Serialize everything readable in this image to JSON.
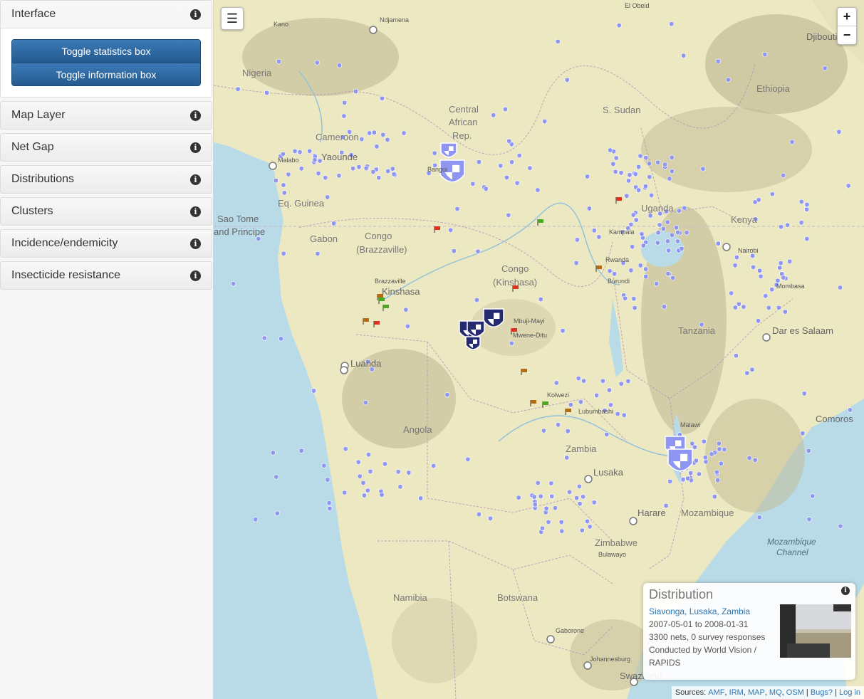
{
  "sidebar": {
    "interface": {
      "title": "Interface",
      "toggle_stats": "Toggle statistics box",
      "toggle_info": "Toggle information box"
    },
    "panels": [
      "Map Layer",
      "Net Gap",
      "Distributions",
      "Clusters",
      "Incidence/endemicity",
      "Insecticide resistance"
    ]
  },
  "map": {
    "menu_icon": "hamburger-icon",
    "zoom_in": "+",
    "zoom_out": "−",
    "labels": {
      "nigeria": "Nigeria",
      "cameroon": "Cameroon",
      "central_african_rep_1": "Central",
      "central_african_rep_2": "African",
      "central_african_rep_3": "Rep.",
      "s_sudan": "S. Sudan",
      "ethiopia": "Ethiopia",
      "eq_guinea": "Eq. Guinea",
      "gabon": "Gabon",
      "congo_brazza_1": "Congo",
      "congo_brazza_2": "(Brazzaville)",
      "congo_kin_1": "Congo",
      "congo_kin_2": "(Kinshasa)",
      "uganda": "Uganda",
      "kenya": "Kenya",
      "rwanda": "Rwanda",
      "burundi": "Burundi",
      "tanzania": "Tanzania",
      "angola": "Angola",
      "zambia": "Zambia",
      "malawi": "Malawi",
      "mozambique": "Mozambique",
      "zimbabwe": "Zimbabwe",
      "namibia": "Namibia",
      "botswana": "Botswana",
      "sao_tome_1": "Sao Tome",
      "sao_tome_2": "and Principe",
      "mozambique_channel_1": "Mozambique",
      "mozambique_channel_2": "Channel",
      "comoros": "Comoros",
      "djibouti": "Djibouti",
      "swaziland": "Swaziland",
      "kinshasa": "Kinshasa",
      "luanda": "Luanda",
      "lusaka": "Lusaka",
      "harare": "Harare",
      "dar_es_salaam": "Dar es Salaam",
      "nairobi": "Nairobi",
      "yaounde": "Yaounde",
      "malabo": "Malabo",
      "ndjamena": "Ndjamena",
      "kano": "Kano",
      "johannesburg": "Johannesburg",
      "gaborone": "Gaborone",
      "mombasa": "Mombasa",
      "el_obeid": "El Obeid",
      "lubumbashi": "Lubumbashi",
      "kolwezi": "Kolwezi",
      "mbuji_mayi": "Mbuji-Mayi",
      "mwene_ditu": "Mwene-Ditu",
      "bulawayo": "Bulawayo",
      "kampala": "Kampala",
      "bangui": "Bangui",
      "brazzaville": "Brazzaville"
    }
  },
  "infobox": {
    "title": "Distribution",
    "location": "Siavonga, Lusaka, Zambia",
    "dates": "2007-05-01 to 2008-01-31",
    "nets": "3300 nets, 0 survey responses",
    "conducted_1": "Conducted by World Vision /",
    "conducted_2": "RAPIDS"
  },
  "attribution": {
    "prefix": "Sources:",
    "amf": "AMF",
    "irm": "IRM",
    "map": "MAP",
    "mq": "MQ",
    "osm": "OSM",
    "bugs": "Bugs?",
    "login": "Log in"
  },
  "colors": {
    "land": "#ece8c2",
    "water": "#b9dbe7",
    "highland": "#b5ad8c",
    "marker_light": "#8f96f2",
    "marker_dark": "#262a6e",
    "flag_red": "#e0301e",
    "flag_green": "#4aaa1f",
    "flag_orange": "#b56b14"
  }
}
